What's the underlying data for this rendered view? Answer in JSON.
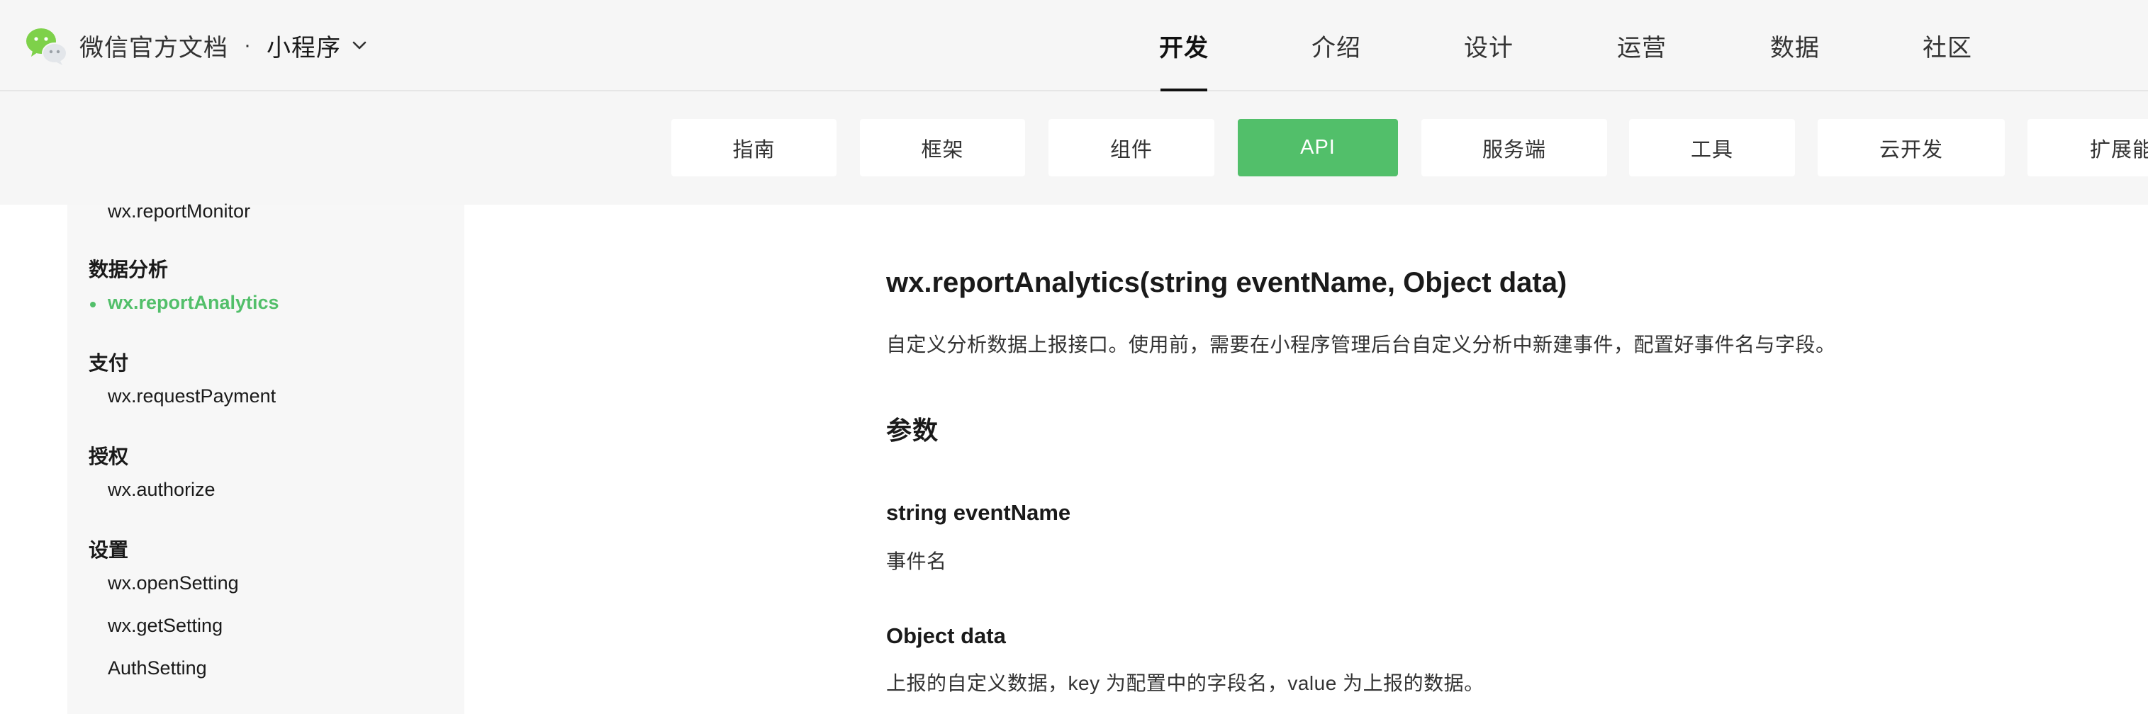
{
  "header": {
    "site_title": "微信官方文档",
    "separator": "·",
    "product": "小程序",
    "nav": [
      {
        "label": "开发",
        "active": true
      },
      {
        "label": "介绍",
        "active": false
      },
      {
        "label": "设计",
        "active": false
      },
      {
        "label": "运营",
        "active": false
      },
      {
        "label": "数据",
        "active": false
      },
      {
        "label": "社区",
        "active": false
      }
    ]
  },
  "subnav": {
    "tabs": [
      {
        "label": "指南",
        "active": false
      },
      {
        "label": "框架",
        "active": false
      },
      {
        "label": "组件",
        "active": false
      },
      {
        "label": "API",
        "active": true
      },
      {
        "label": "服务端",
        "active": false
      },
      {
        "label": "工具",
        "active": false
      },
      {
        "label": "云开发",
        "active": false
      },
      {
        "label": "扩展能力",
        "active": false
      }
    ]
  },
  "sidebar": {
    "entries": [
      {
        "type": "item",
        "label": "wx.reportMonitor",
        "active": false
      },
      {
        "type": "group",
        "label": "数据分析"
      },
      {
        "type": "item",
        "label": "wx.reportAnalytics",
        "active": true
      },
      {
        "type": "group",
        "label": "支付"
      },
      {
        "type": "item",
        "label": "wx.requestPayment",
        "active": false
      },
      {
        "type": "group",
        "label": "授权"
      },
      {
        "type": "item",
        "label": "wx.authorize",
        "active": false
      },
      {
        "type": "group",
        "label": "设置"
      },
      {
        "type": "item",
        "label": "wx.openSetting",
        "active": false
      },
      {
        "type": "item",
        "label": "wx.getSetting",
        "active": false
      },
      {
        "type": "item",
        "label": "AuthSetting",
        "active": false
      }
    ]
  },
  "content": {
    "title": "wx.reportAnalytics(string eventName, Object data)",
    "description": "自定义分析数据上报接口。使用前，需要在小程序管理后台自定义分析中新建事件，配置好事件名与字段。",
    "params_heading": "参数",
    "params": [
      {
        "name": "string eventName",
        "desc": "事件名"
      },
      {
        "name": "Object data",
        "desc": "上报的自定义数据，key 为配置中的字段名，value 为上报的数据。"
      }
    ]
  },
  "colors": {
    "accent": "#52bf6a",
    "header_bg": "#f6f6f6",
    "sidebar_bg": "#f7f7f7"
  },
  "icons": {
    "logo": "wechat-logo-icon",
    "product_dropdown": "chevron-down-icon"
  }
}
